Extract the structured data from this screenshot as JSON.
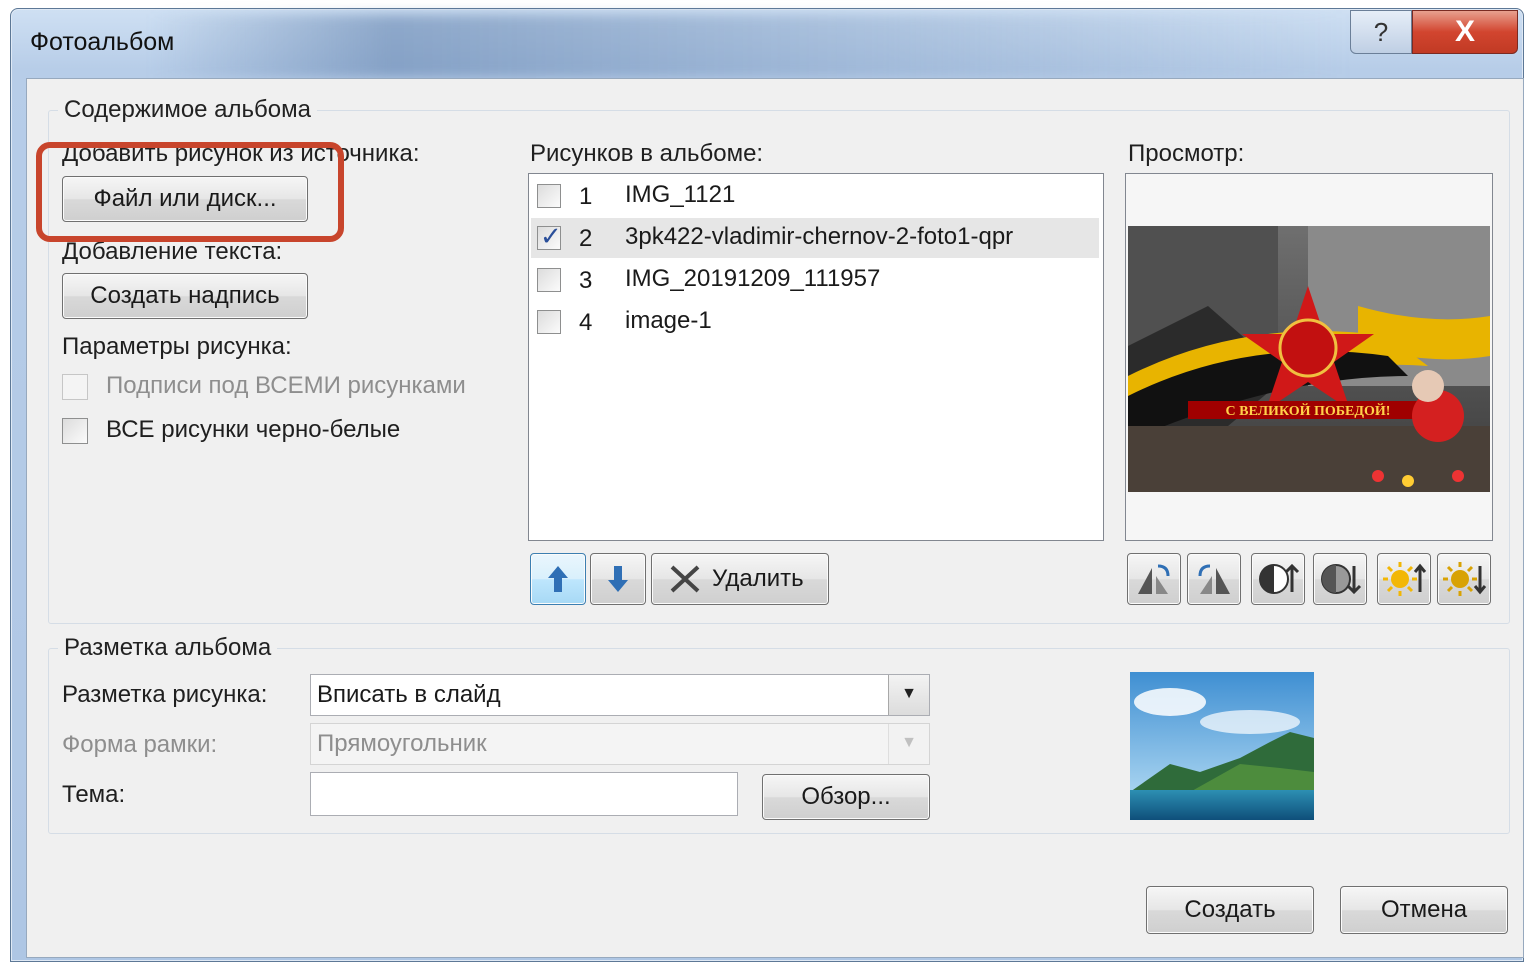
{
  "window": {
    "title": "Фотоальбом",
    "help_label": "?",
    "close_label": "X"
  },
  "album_content": {
    "group_label": "Содержимое альбома",
    "insert_from_label": "Добавить рисунок из источника:",
    "file_button_label": "Файл или диск...",
    "insert_text_label": "Добавление текста:",
    "new_textbox_label": "Создать надпись",
    "picture_options_label": "Параметры рисунка:",
    "captions_option_label": "Подписи под ВСЕМИ рисунками",
    "captions_checked": false,
    "captions_enabled": false,
    "bw_option_label": "ВСЕ рисунки черно-белые",
    "bw_checked": false
  },
  "pictures": {
    "label": "Рисунков в альбоме:",
    "items": [
      {
        "num": "1",
        "name": "IMG_1121",
        "checked": false,
        "selected": false
      },
      {
        "num": "2",
        "name": "3pk422-vladimir-chernov-2-foto1-qpr",
        "checked": true,
        "selected": true
      },
      {
        "num": "3",
        "name": "IMG_20191209_111957",
        "checked": false,
        "selected": false
      },
      {
        "num": "4",
        "name": "image-1",
        "checked": false,
        "selected": false
      }
    ],
    "move_up_icon": "arrow-up-icon",
    "move_down_icon": "arrow-down-icon",
    "remove_label": "Удалить"
  },
  "preview": {
    "label": "Просмотр:",
    "banner_text": "С ВЕЛИКОЙ ПОБЕДОЙ!",
    "tools": [
      "rotate-left-icon",
      "rotate-right-icon",
      "contrast-up-icon",
      "contrast-down-icon",
      "brightness-up-icon",
      "brightness-down-icon"
    ]
  },
  "layout": {
    "group_label": "Разметка альбома",
    "picture_layout_label": "Разметка рисунка:",
    "picture_layout_value": "Вписать в слайд",
    "frame_shape_label": "Форма рамки:",
    "frame_shape_value": "Прямоугольник",
    "theme_label": "Тема:",
    "theme_value": "",
    "browse_label": "Обзор..."
  },
  "footer": {
    "create_label": "Создать",
    "cancel_label": "Отмена"
  },
  "colors": {
    "highlight": "#c8452c",
    "title_bar": "#b7cde8",
    "client": "#f0f0f0",
    "close_button": "#d2452f"
  }
}
